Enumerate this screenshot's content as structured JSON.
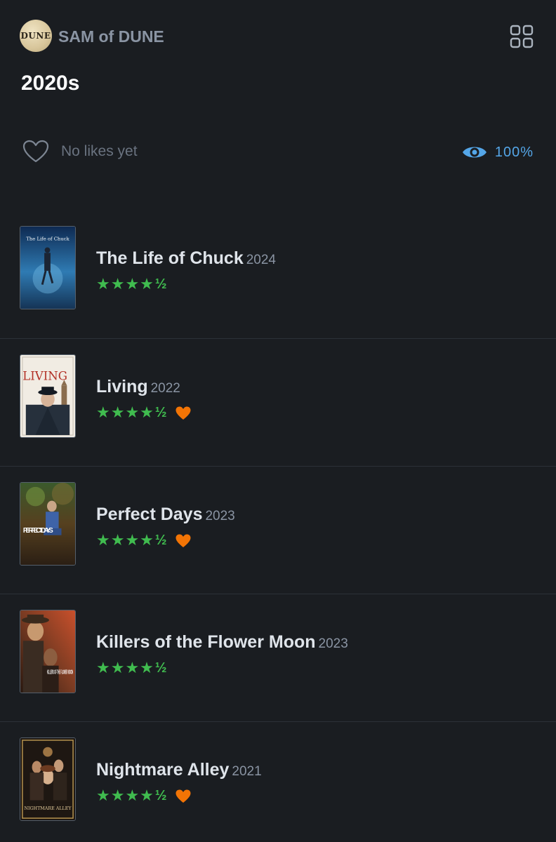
{
  "header": {
    "avatar_text": "DUNE",
    "username": "SAM of DUNE"
  },
  "list": {
    "title": "2020s",
    "likes_text": "No likes yet",
    "watched_percent": "100%"
  },
  "colors": {
    "background": "#1a1d21",
    "star_green": "#40bc4f",
    "heart_orange": "#f27405",
    "watched_blue": "#54a6e8"
  },
  "films": [
    {
      "title": "The Life of Chuck",
      "year": "2024",
      "rating_stars": "★★★★",
      "rating_half": "½",
      "liked": false,
      "poster_text": "The Life of Chuck"
    },
    {
      "title": "Living",
      "year": "2022",
      "rating_stars": "★★★★",
      "rating_half": "½",
      "liked": true,
      "poster_text": "LIVING"
    },
    {
      "title": "Perfect Days",
      "year": "2023",
      "rating_stars": "★★★★",
      "rating_half": "½",
      "liked": true,
      "poster_text": "PERFECT DAYS"
    },
    {
      "title": "Killers of the Flower Moon",
      "year": "2023",
      "rating_stars": "★★★★",
      "rating_half": "½",
      "liked": false,
      "poster_text": "KILLERS OF THE FLOWER MOON"
    },
    {
      "title": "Nightmare Alley",
      "year": "2021",
      "rating_stars": "★★★★",
      "rating_half": "½",
      "liked": true,
      "poster_text": "NIGHTMARE ALLEY"
    }
  ]
}
